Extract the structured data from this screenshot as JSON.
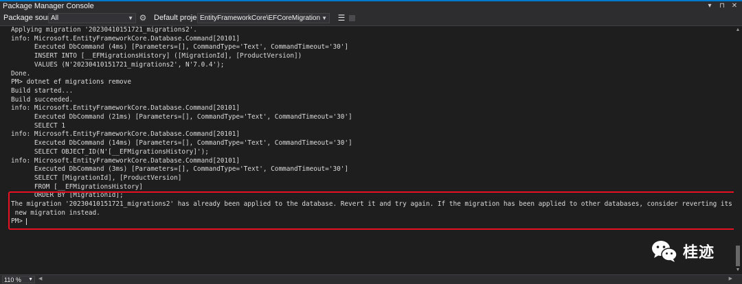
{
  "window": {
    "title": "Package Manager Console"
  },
  "toolbar": {
    "package_source_label": "Package source:",
    "package_source_value": "All",
    "default_project_label": "Default project:",
    "default_project_value": "EntityFrameworkCore\\EFCoreMigration"
  },
  "console": {
    "lines": [
      "Applying migration '20230410151721_migrations2'.",
      "info: Microsoft.EntityFrameworkCore.Database.Command[20101]",
      "      Executed DbCommand (4ms) [Parameters=[], CommandType='Text', CommandTimeout='30']",
      "      INSERT INTO [__EFMigrationsHistory] ([MigrationId], [ProductVersion])",
      "      VALUES (N'20230410151721_migrations2', N'7.0.4');",
      "Done.",
      "PM> dotnet ef migrations remove",
      "Build started...",
      "Build succeeded.",
      "info: Microsoft.EntityFrameworkCore.Database.Command[20101]",
      "      Executed DbCommand (21ms) [Parameters=[], CommandType='Text', CommandTimeout='30']",
      "      SELECT 1",
      "info: Microsoft.EntityFrameworkCore.Database.Command[20101]",
      "      Executed DbCommand (14ms) [Parameters=[], CommandType='Text', CommandTimeout='30']",
      "      SELECT OBJECT_ID(N'[__EFMigrationsHistory]');",
      "info: Microsoft.EntityFrameworkCore.Database.Command[20101]",
      "      Executed DbCommand (3ms) [Parameters=[], CommandType='Text', CommandTimeout='30']",
      "      SELECT [MigrationId], [ProductVersion]",
      "      FROM [__EFMigrationsHistory]",
      "      ORDER BY [MigrationId];",
      "The migration '20230410151721_migrations2' has already been applied to the database. Revert it and try again. If the migration has been applied to other databases, consider reverting its changes using a",
      " new migration instead.",
      "PM>"
    ]
  },
  "watermark": {
    "text": "桂迹"
  },
  "statusbar": {
    "zoom": "110 %"
  },
  "colors": {
    "background": "#1e1e1e",
    "chrome": "#2d2d30",
    "text": "#dcdcdc",
    "highlight_border": "#e81123",
    "accent": "#007acc"
  }
}
